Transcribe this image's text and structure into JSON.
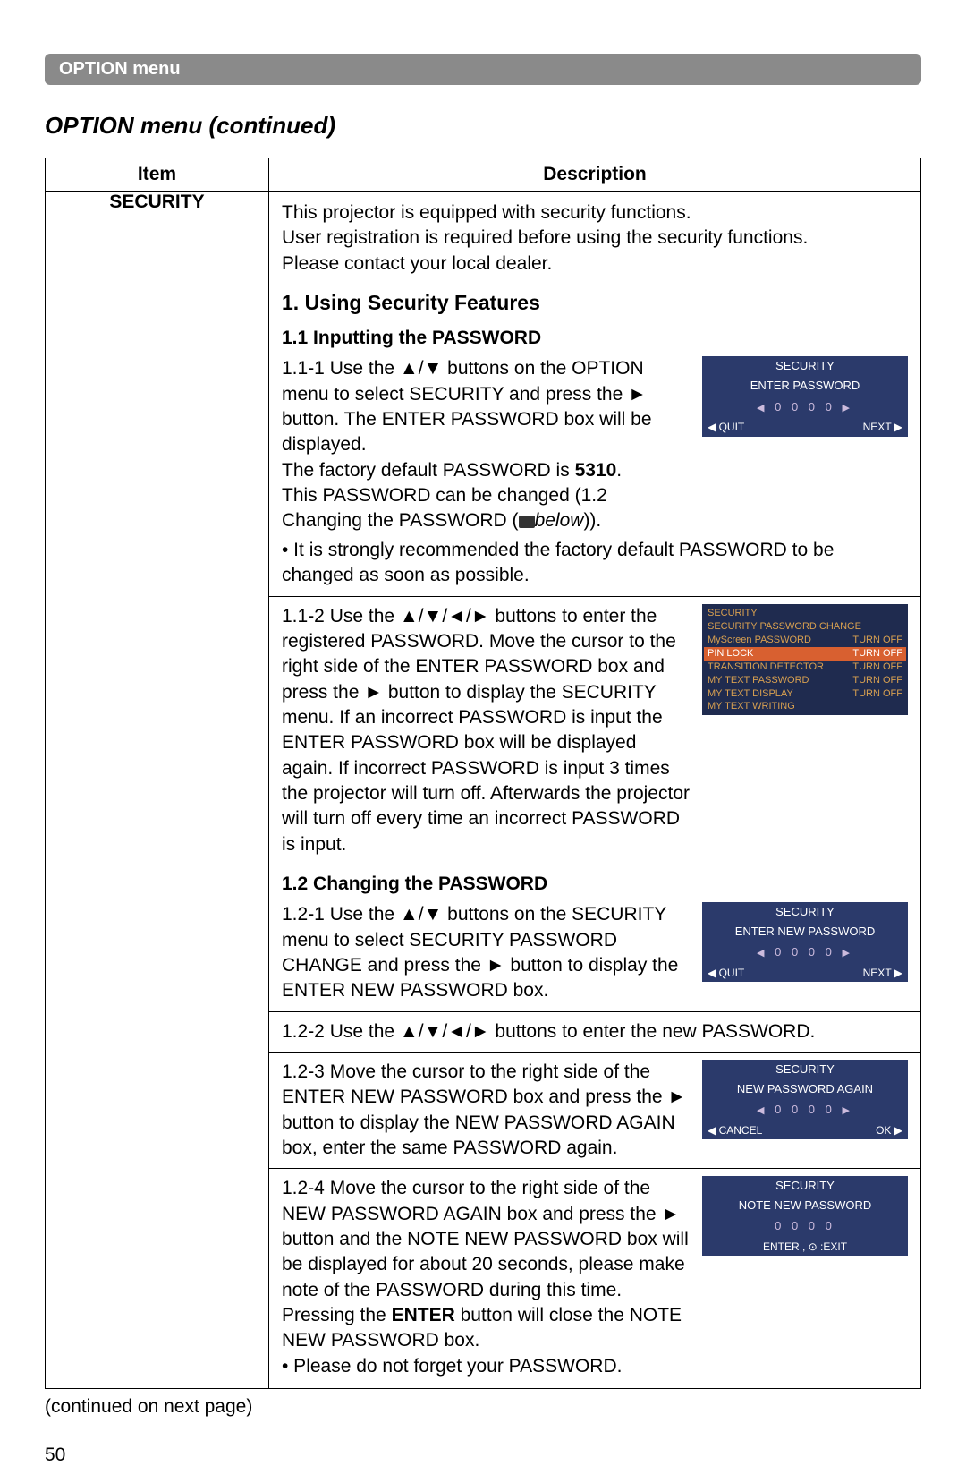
{
  "header": {
    "label": "OPTION menu"
  },
  "title": "OPTION menu (continued)",
  "table": {
    "headers": {
      "item": "Item",
      "desc": "Description"
    },
    "item": "SECURITY",
    "intro": {
      "l1": "This projector is equipped with security functions.",
      "l2": "User registration is required before using the security functions.",
      "l3": "Please contact your local dealer."
    },
    "h1": "1. Using Security Features",
    "h11": "1.1 Inputting the PASSWORD",
    "s111": {
      "num": "1.1-1",
      "p1": "Use the ▲/▼ buttons on the OPTION menu to select SECURITY and press the ► button. The ENTER PASSWORD box will be displayed.",
      "p2a": "The factory default PASSWORD is ",
      "p2b": "5310",
      "p2c": ".",
      "p3": "This PASSWORD can be changed (1.2 Changing the PASSWORD (",
      "p3b": "below",
      "p3c": ")).",
      "p4": "• It is strongly recommended the factory default PASSWORD to be changed as soon as possible."
    },
    "s112": {
      "num": "1.1-2",
      "p1": "Use the ▲/▼/◄/► buttons to enter the registered PASSWORD. Move the cursor to the right side of the ENTER PASSWORD box and press the ► button to display the SECURITY menu.",
      "p2": "If an incorrect PASSWORD is input the ENTER PASSWORD box will be displayed again. If incorrect PASSWORD is input 3 times the projector will turn off. Afterwards the projector will turn off every time an incorrect PASSWORD is input."
    },
    "h12": "1.2 Changing the PASSWORD",
    "s121": {
      "num": "1.2-1",
      "p1": "Use the ▲/▼ buttons on the SECURITY menu to select SECURITY PASSWORD CHANGE and press the ► button to display the ENTER NEW PASSWORD box."
    },
    "s122": {
      "num": "1.2-2",
      "p1": "Use the ▲/▼/◄/► buttons to enter the new PASSWORD."
    },
    "s123": {
      "num": "1.2-3",
      "p1": "Move the cursor to the right side of the ENTER NEW PASSWORD box and press the ► button to display the NEW PASSWORD AGAIN box, enter the same PASSWORD again."
    },
    "s124": {
      "num": "1.2-4",
      "p1": "Move the cursor to the right side of the NEW PASSWORD AGAIN box and press the ► button and the NOTE NEW PASSWORD box will be displayed for about 20 seconds, please make note of the PASSWORD during this time.",
      "p2a": "Pressing the ",
      "p2b": "ENTER",
      "p2c": " button will close the NOTE NEW PASSWORD box.",
      "p3": "• Please do not forget your PASSWORD."
    }
  },
  "osd1": {
    "title": "SECURITY",
    "sub": "ENTER PASSWORD",
    "digits": "0 0 0 0",
    "left": "QUIT",
    "right": "NEXT"
  },
  "osd2": {
    "title": "SECURITY",
    "rows": [
      {
        "label": "SECURITY PASSWORD CHANGE",
        "val": ""
      },
      {
        "label": "MyScreen PASSWORD",
        "val": "TURN OFF"
      },
      {
        "label": "PIN LOCK",
        "val": "TURN OFF",
        "hi": true
      },
      {
        "label": "TRANSITION DETECTOR",
        "val": "TURN OFF"
      },
      {
        "label": "MY TEXT PASSWORD",
        "val": "TURN OFF"
      },
      {
        "label": "MY TEXT DISPLAY",
        "val": "TURN OFF"
      },
      {
        "label": "MY TEXT WRITING",
        "val": ""
      }
    ]
  },
  "osd3": {
    "title": "SECURITY",
    "sub": "ENTER NEW PASSWORD",
    "digits": "0 0 0 0",
    "left": "QUIT",
    "right": "NEXT"
  },
  "osd4": {
    "title": "SECURITY",
    "sub": "NEW PASSWORD AGAIN",
    "digits": "0 0 0 0",
    "left": "CANCEL",
    "right": "OK"
  },
  "osd5": {
    "title": "SECURITY",
    "sub": "NOTE NEW PASSWORD",
    "digits": "0 0 0 0",
    "center": "ENTER , ⊙ :EXIT"
  },
  "footer": {
    "cont": "(continued on next page)",
    "page": "50"
  }
}
